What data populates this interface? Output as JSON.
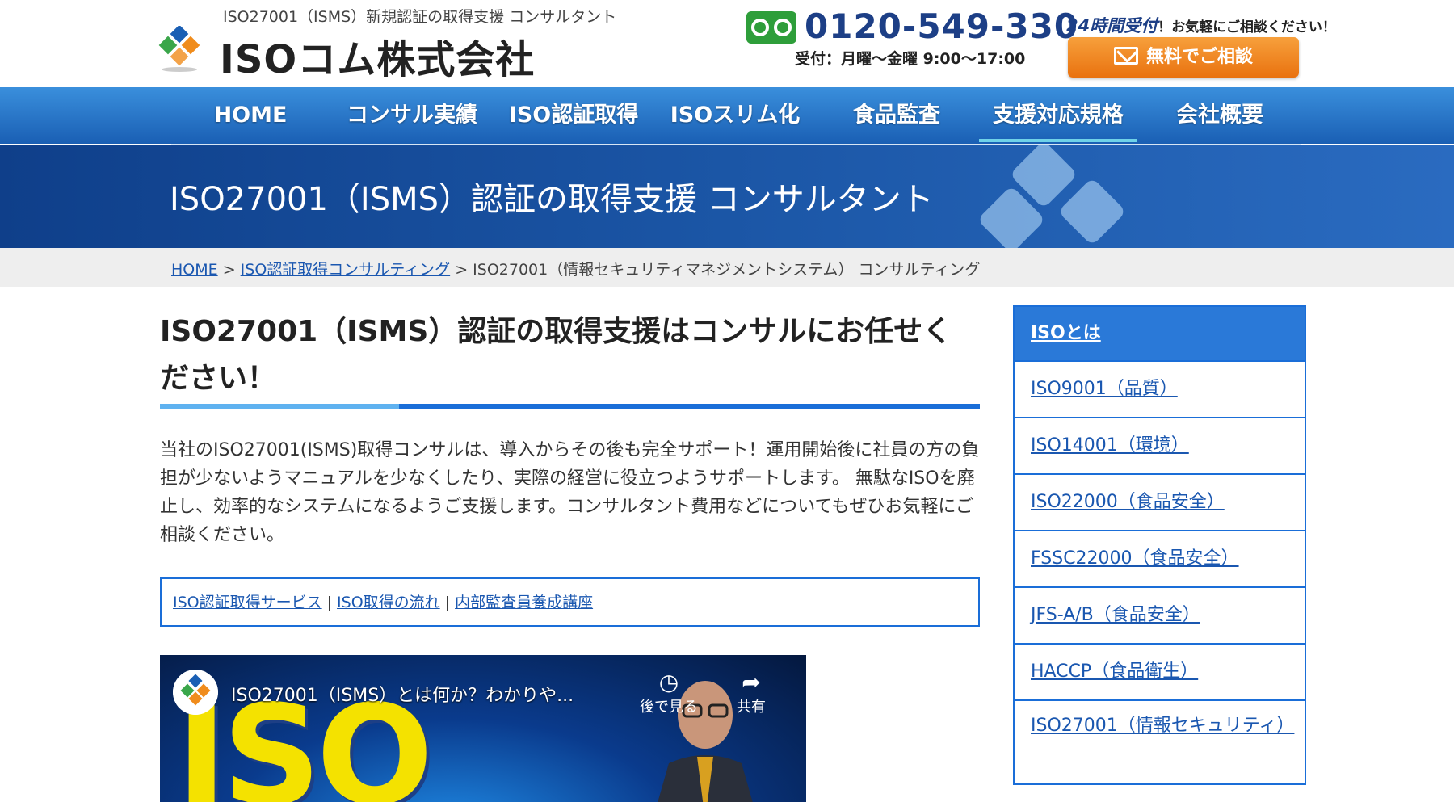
{
  "header": {
    "tagline": "ISO27001（ISMS）新規認証の取得支援 コンサルタント",
    "company_name": "ISOコム株式会社",
    "tel_number": "0120-549-330",
    "tel_hours": "受付：月曜〜金曜 9:00〜17:00",
    "reception_24": "24時間受付",
    "reception_text": "！お気軽にご相談ください！",
    "consult_button": "無料でご相談"
  },
  "nav": {
    "items": [
      {
        "label": "HOME"
      },
      {
        "label": "コンサル実績"
      },
      {
        "label": "ISO認証取得"
      },
      {
        "label": "ISOスリム化"
      },
      {
        "label": "食品監査"
      },
      {
        "label": "支援対応規格"
      },
      {
        "label": "会社概要"
      }
    ]
  },
  "banner": {
    "title": "ISO27001（ISMS）認証の取得支援 コンサルタント"
  },
  "breadcrumb": {
    "home": "HOME",
    "separator": ">",
    "parent": "ISO認証取得コンサルティング",
    "current": "ISO27001（情報セキュリティマネジメントシステム） コンサルティング"
  },
  "main": {
    "heading": "ISO27001（ISMS）認証の取得支援はコンサルにお任せください！",
    "intro": "当社のISO27001(ISMS)取得コンサルは、導入からその後も完全サポート！運用開始後に社員の方の負担が少ないようマニュアルを少なくしたり、実際の経営に役立つようサポートします。 無駄なISOを廃止し、効率的なシステムになるようご支援します。コンサルタント費用などについてもぜひお気軽にご相談ください。",
    "links": [
      {
        "label": "ISO認証取得サービス"
      },
      {
        "label": "ISO取得の流れ"
      },
      {
        "label": "内部監査員養成講座"
      }
    ],
    "link_separator": "|"
  },
  "video": {
    "big_text": "ISO",
    "title": "ISO27001（ISMS）とは何か？わかりや...",
    "watch_later": "後で見る",
    "share": "共有"
  },
  "sidebar": {
    "heading": "ISOとは",
    "items": [
      {
        "label": "ISO9001（品質）"
      },
      {
        "label": "ISO14001（環境）"
      },
      {
        "label": "ISO22000（食品安全）"
      },
      {
        "label": "FSSC22000（食品安全）"
      },
      {
        "label": "JFS-A/B（食品安全）"
      },
      {
        "label": "HACCP（食品衛生）"
      },
      {
        "label": "ISO27001（情報セキュリティ）"
      }
    ]
  },
  "colors": {
    "nav_blue": "#1a5fb4",
    "accent_blue": "#1a6ed8",
    "cta_orange": "#e9720f",
    "tel_green": "#2e9e3a"
  }
}
